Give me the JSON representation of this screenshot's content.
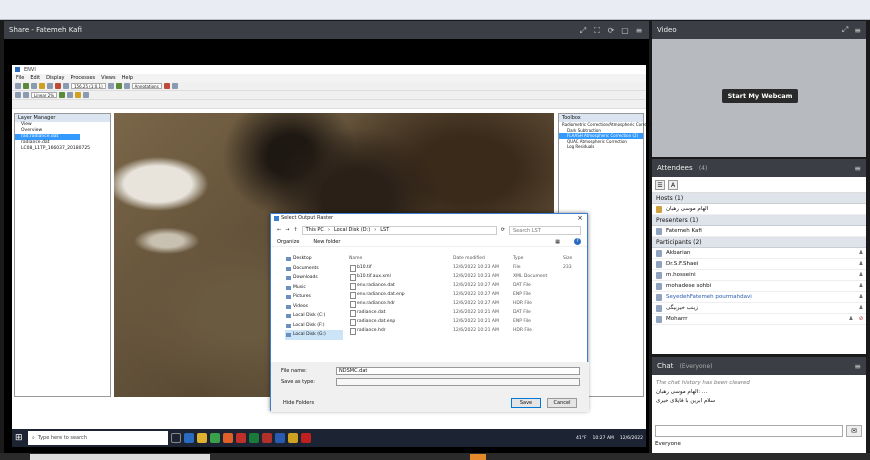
{
  "share": {
    "title": "Share - Fatemeh Kafi"
  },
  "envi": {
    "title": "ENVI",
    "menu": [
      "File",
      "Edit",
      "Display",
      "Views",
      "Help"
    ],
    "menu_mid": "Processes",
    "zoom": "156.25 (1:0.1)",
    "annotations": "Annotations",
    "layer_manager": {
      "header": "Layer Manager",
      "items": [
        "View",
        "Overview",
        "rad.radiance.dat",
        "radiance.dat",
        "LC08_L1TP_166037_20180725"
      ]
    },
    "toolbox": {
      "header": "Toolbox",
      "path": "Radiometric Correction/Atmospheric Correction",
      "items": [
        "Dark Subtraction",
        "FLAASH Atmospheric Correction (2)",
        "QUAC Atmospheric Correction",
        "Log Residuals",
        "Haze Removal"
      ]
    },
    "stretch": "Linear 2%"
  },
  "dialog": {
    "title": "Select Output Raster",
    "path": [
      "This PC",
      "Local Disk (D:)",
      "LST"
    ],
    "search": "Search LST",
    "organize": "Organize",
    "new_folder": "New folder",
    "sidebar": [
      "Desktop",
      "Documents",
      "Downloads",
      "Music",
      "Pictures",
      "Videos",
      "Local Disk (C:)",
      "Local Disk (F:)",
      "Local Disk (G:)"
    ],
    "columns": [
      "Name",
      "Date modified",
      "Type",
      "Size"
    ],
    "files": [
      {
        "name": "b10.tif",
        "date": "12/6/2022 10:23 AM",
        "type": "File",
        "size": "233"
      },
      {
        "name": "b10.tif.aux.xml",
        "date": "12/6/2022 10:23 AM",
        "type": "XML Document",
        "size": ""
      },
      {
        "name": "env.radiance.dat",
        "date": "12/6/2022 10:27 AM",
        "type": "DAT File",
        "size": ""
      },
      {
        "name": "env.radiance.dat.enp",
        "date": "12/6/2022 10:27 AM",
        "type": "ENP File",
        "size": ""
      },
      {
        "name": "env.radiance.hdr",
        "date": "12/6/2022 10:27 AM",
        "type": "HDR File",
        "size": ""
      },
      {
        "name": "radiance.dat",
        "date": "12/6/2022 10:21 AM",
        "type": "DAT File",
        "size": ""
      },
      {
        "name": "radiance.dat.enp",
        "date": "12/6/2022 10:21 AM",
        "type": "ENP File",
        "size": ""
      },
      {
        "name": "radiance.hdr",
        "date": "12/6/2022 10:21 AM",
        "type": "HDR File",
        "size": ""
      }
    ],
    "file_name_label": "File name:",
    "file_name_value": "NDSMC.dat",
    "save_type_label": "Save as type:",
    "save_type_value": "",
    "save_btn": "Save",
    "cancel_btn": "Cancel",
    "hide_folders": "Hide Folders"
  },
  "taskbar": {
    "search": "Type here to search",
    "weather": "41°F",
    "time": "10:27 AM",
    "date": "12/6/2022"
  },
  "video": {
    "title": "Video",
    "webcam_btn": "Start My Webcam"
  },
  "attendees": {
    "title": "Attendees",
    "count": "(4)",
    "hosts_label": "Hosts (1)",
    "hosts": [
      "الهام موسی رهبان"
    ],
    "presenters_label": "Presenters (1)",
    "presenters": [
      "Fatemeh Kafi"
    ],
    "participants_label": "Participants (2)",
    "participants": [
      "Akbarian",
      "Dr.S.F.Shaei",
      "m.hosseini",
      "mohadese sohbi",
      "SeyedehFatemeh pourmahdavi",
      "زینب خیربیگی",
      "Moharrr"
    ]
  },
  "chat": {
    "title": "Chat",
    "scope": "(Everyone)",
    "messages": [
      "The chat history has been cleared",
      "الهام موسی رهبان: ...",
      "سلام ابرین با فایلای خیری"
    ],
    "to": "Everyone"
  }
}
